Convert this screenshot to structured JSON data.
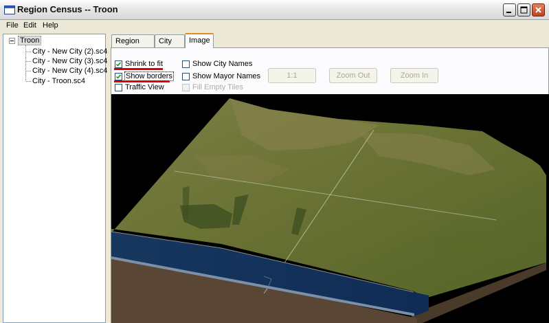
{
  "window": {
    "title": "Region Census -- Troon"
  },
  "menu": [
    "File",
    "Edit",
    "Help"
  ],
  "tree": {
    "root": "Troon",
    "children": [
      "City - New City (2).sc4",
      "City - New City (3).sc4",
      "City - New City (4).sc4",
      "City - Troon.sc4"
    ]
  },
  "tabs": [
    "Region Info",
    "City Info",
    "Image"
  ],
  "options": {
    "shrink_to_fit": "Shrink to fit",
    "show_borders": "Show borders",
    "traffic_view": "Traffic View",
    "show_city_names": "Show City Names",
    "show_mayor_names": "Show Mayor Names",
    "fill_empty_tiles": "Fill Empty Tiles"
  },
  "buttons": {
    "one_to_one": "1:1",
    "zoom_out": "Zoom Out",
    "zoom_in": "Zoom In"
  },
  "colors": {
    "annotation": "#e00000",
    "water": "#15355f",
    "terrain": "#6b7335",
    "tab_highlight": "#e68b2c"
  }
}
